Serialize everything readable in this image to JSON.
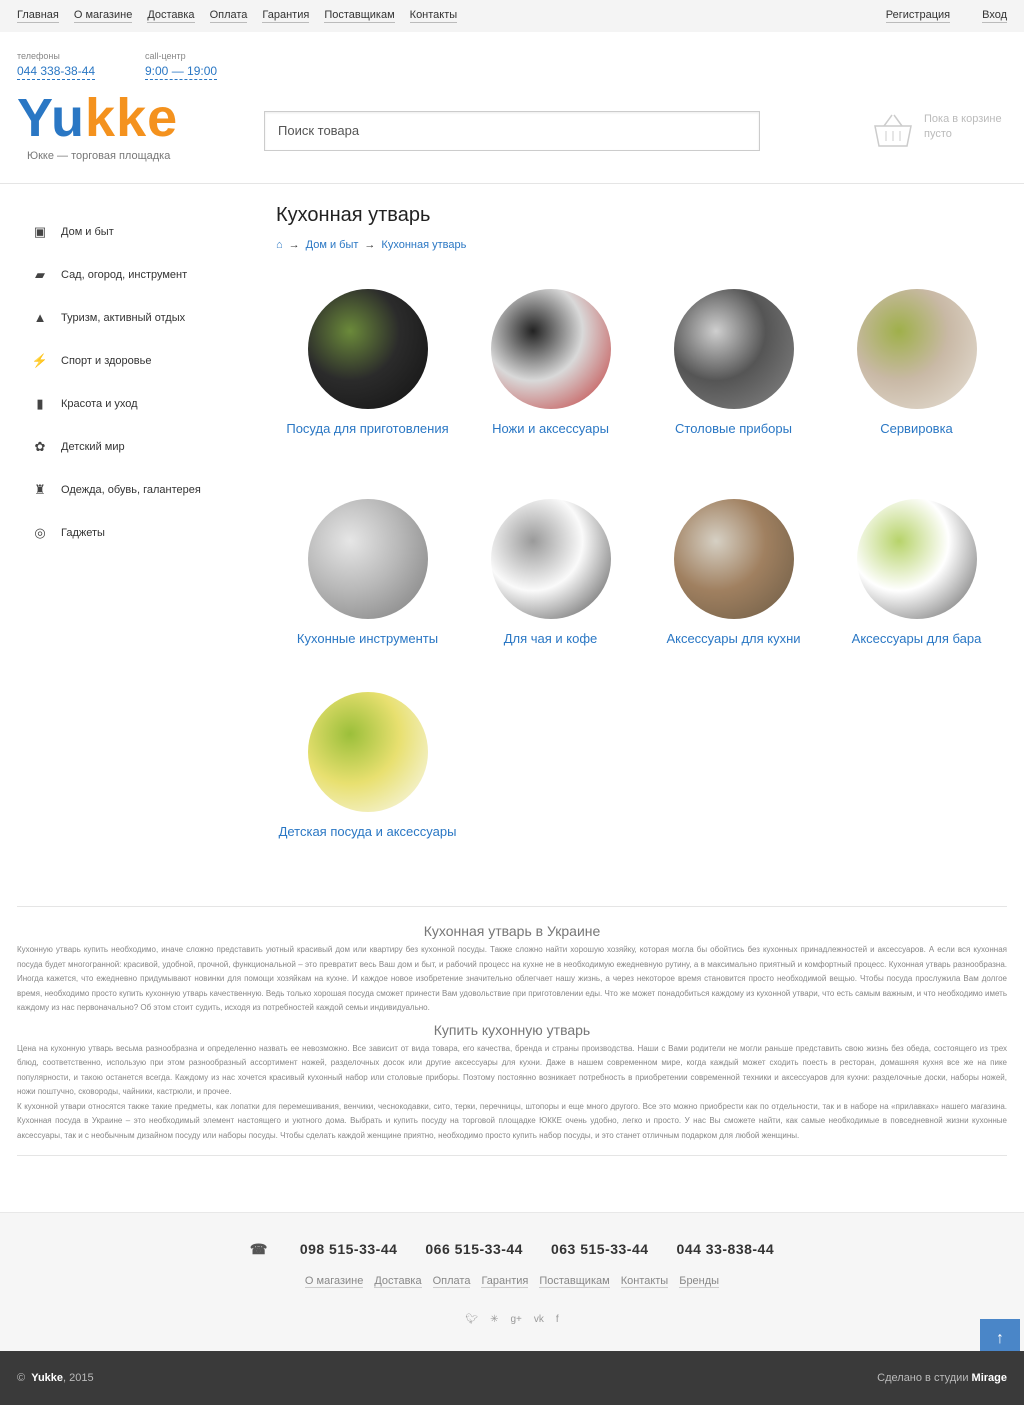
{
  "topbar": {
    "nav": [
      "Главная",
      "О магазине",
      "Доставка",
      "Оплата",
      "Гарантия",
      "Поставщикам",
      "Контакты"
    ],
    "register": "Регистрация",
    "login": "Вход"
  },
  "header": {
    "phone_label": "телефоны",
    "phone": "044 338-38-44",
    "callcenter_label": "call-центр",
    "hours": "9:00 — 19:00",
    "logo_part1": "Yu",
    "logo_part2": "kke",
    "tagline": "Юкке — торговая площадка",
    "search_placeholder": "Поиск товара",
    "cart_empty_line1": "Пока в корзине",
    "cart_empty_line2": "пусто"
  },
  "sidebar": {
    "items": [
      {
        "label": "Дом и быт",
        "icon": "house-icon"
      },
      {
        "label": "Сад, огород, инструмент",
        "icon": "drill-icon"
      },
      {
        "label": "Туризм, активный отдых",
        "icon": "tent-icon"
      },
      {
        "label": "Спорт и здоровье",
        "icon": "runner-icon"
      },
      {
        "label": "Красота и уход",
        "icon": "lipstick-icon"
      },
      {
        "label": "Детский мир",
        "icon": "teddy-bear-icon"
      },
      {
        "label": "Одежда, обувь, галантерея",
        "icon": "jacket-icon"
      },
      {
        "label": "Гаджеты",
        "icon": "watch-icon"
      }
    ]
  },
  "main": {
    "title": "Кухонная утварь",
    "breadcrumb": [
      "Дом и быт",
      "Кухонная утварь"
    ],
    "categories": [
      {
        "label": "Посуда для приготовления",
        "colors": [
          "#2b2b2b",
          "#6b8a3a",
          "#111"
        ]
      },
      {
        "label": "Ножи и аксессуары",
        "colors": [
          "#d9d9d9",
          "#222",
          "#c03030"
        ]
      },
      {
        "label": "Столовые приборы",
        "colors": [
          "#555",
          "#cfcfcf",
          "#888"
        ]
      },
      {
        "label": "Сервировка",
        "colors": [
          "#c9b9a6",
          "#9fb04a",
          "#e8e2d8"
        ]
      },
      {
        "label": "Кухонные инструменты",
        "colors": [
          "#b8b8b8",
          "#e6e6e6",
          "#7a7a7a"
        ]
      },
      {
        "label": "Для чая и кофе",
        "colors": [
          "#fafafa",
          "#9a9a9a",
          "#444"
        ]
      },
      {
        "label": "Аксессуары для кухни",
        "colors": [
          "#a08060",
          "#d6d0c4",
          "#6a5a44"
        ]
      },
      {
        "label": "Аксессуары для бара",
        "colors": [
          "#fff",
          "#b7d36a",
          "#555"
        ]
      },
      {
        "label": "Детская посуда и аксессуары",
        "colors": [
          "#e8e070",
          "#9bbf3a",
          "#fafafa"
        ]
      }
    ]
  },
  "seo": {
    "heading1": "Кухонная утварь в Украине",
    "p1": "Кухонную утварь купить необходимо, иначе сложно представить уютный красивый дом или квартиру без кухонной посуды. Также сложно найти хорошую хозяйку, которая могла бы обойтись без кухонных принадлежностей и аксессуаров. А если вся кухонная посуда будет многогранной: красивой, удобной, прочной, функциональной – это превратит весь Ваш дом и быт, и рабочий процесс на кухне не в необходимую ежедневную рутину, а в максимально приятный и комфортный процесс. Кухонная утварь разнообразна. Иногда кажется, что ежедневно придумывают новинки для помощи хозяйкам на кухне. И каждое новое изобретение значительно облегчает нашу жизнь, а через некоторое время становится просто необходимой вещью. Чтобы посуда прослужила Вам долгое время, необходимо просто купить кухонную утварь качественную. Ведь только хорошая посуда сможет принести Вам удовольствие при приготовлении еды. Что же может понадобиться каждому из кухонной утвари, что есть самым важным, и что необходимо иметь каждому из нас первоначально? Об этом стоит судить, исходя из потребностей каждой семьи индивидуально.",
    "heading2": "Купить кухонную утварь",
    "p2": "Цена на кухонную утварь весьма разнообразна и определенно назвать ее невозможно. Все зависит от вида товара, его качества, бренда и страны производства. Наши с Вами родители не могли раньше представить свою жизнь без обеда, состоящего из трех блюд, соответственно, использую при этом разнообразный ассортимент ножей, разделочных досок или другие аксессуары для кухни. Даже в нашем современном мире, когда каждый может сходить поесть в ресторан, домашняя кухня все же на пике популярности, и такою останется всегда. Каждому из нас хочется красивый кухонный набор или столовые приборы. Поэтому постоянно возникает потребность в приобретении современной техники и аксессуаров для кухни: разделочные доски, наборы ножей, ножи поштучно, сковороды, чайники, кастрюли, и прочее.",
    "p3": "К кухонной утвари относятся также такие предметы, как лопатки для перемешивания, венчики, чеснокодавки, сито, терки, перечницы, штопоры и еще много другого. Все это можно приобрести как по отдельности, так и в наборе на «прилавках» нашего магазина. Кухонная посуда в Украине – это необходимый элемент настоящего и уютного дома. Выбрать и купить посуду на торговой площадке ЮККЕ очень удобно, легко и просто. У нас Вы сможете найти, как самые необходимые в повседневной жизни кухонные аксессуары, так и с необычным дизайном посуду или наборы посуды. Чтобы сделать каждой женщине приятно, необходимо просто купить набор посуды, и это станет отличным подарком для любой женщины."
  },
  "footer": {
    "phones": [
      "098 515-33-44",
      "066 515-33-44",
      "063 515-33-44",
      "044 33-838-44"
    ],
    "nav": [
      "О магазине",
      "Доставка",
      "Оплата",
      "Гарантия",
      "Поставщикам",
      "Контакты",
      "Бренды"
    ],
    "social": [
      "twitter-icon",
      "odnoklassniki-icon",
      "google-plus-icon",
      "vk-icon",
      "facebook-icon"
    ],
    "copyright_symbol": "©",
    "brand": "Yukke",
    "year": ", 2015",
    "studio_text": "Сделано в студии",
    "studio": "Mirage"
  }
}
